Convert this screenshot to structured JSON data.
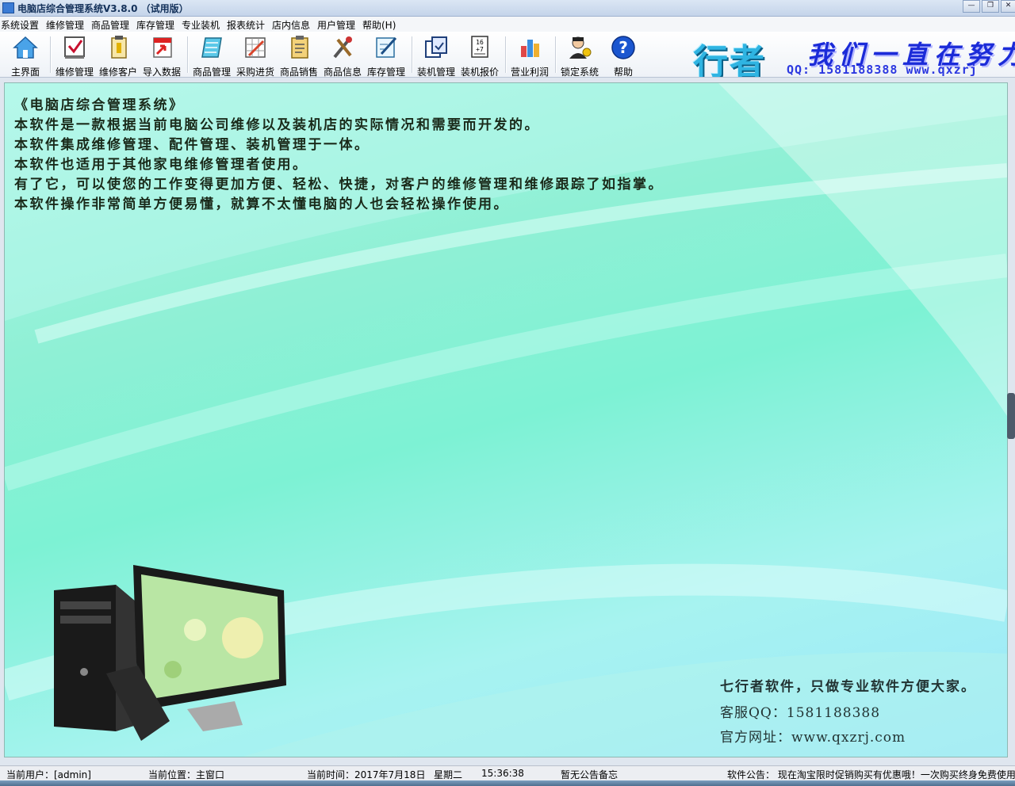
{
  "window": {
    "title": "电脑店综合管理系统V3.8.0 （试用版）",
    "controls": [
      "—",
      "❐",
      "✕"
    ]
  },
  "menu": [
    "系统设置",
    "维修管理",
    "商品管理",
    "库存管理",
    "专业装机",
    "报表统计",
    "店内信息",
    "用户管理",
    "帮助(H)"
  ],
  "toolbar": {
    "buttons": [
      {
        "label": "主界面",
        "icon": "house-icon"
      },
      {
        "label": "维修管理",
        "icon": "checkbox-board-icon"
      },
      {
        "label": "维修客户",
        "icon": "customer-card-icon"
      },
      {
        "label": "导入数据",
        "icon": "import-arrow-icon"
      },
      {
        "label": "商品管理",
        "icon": "notebook-icon"
      },
      {
        "label": "采购进货",
        "icon": "purchase-grid-icon"
      },
      {
        "label": "商品销售",
        "icon": "sales-clipboard-icon"
      },
      {
        "label": "商品信息",
        "icon": "tools-icon"
      },
      {
        "label": "库存管理",
        "icon": "inventory-pencil-icon"
      },
      {
        "label": "装机管理",
        "icon": "assembly-docs-icon"
      },
      {
        "label": "装机报价",
        "icon": "quote-calculator-icon"
      },
      {
        "label": "营业利润",
        "icon": "bar-chart-icon"
      },
      {
        "label": "锁定系统",
        "icon": "lock-user-icon"
      },
      {
        "label": "帮助",
        "icon": "help-icon"
      }
    ]
  },
  "brand": {
    "name": "行者",
    "slogan": "我们一直在努力",
    "contact": "QQ: 1581188388  www.qxzrj"
  },
  "intro": [
    "《电脑店综合管理系统》",
    "本软件是一款根据当前电脑公司维修以及装机店的实际情况和需要而开发的。",
    "本软件集成维修管理、配件管理、装机管理于一体。",
    "本软件也适用于其他家电维修管理者使用。",
    "有了它，可以使您的工作变得更加方便、轻松、快捷，对客户的维修管理和维修跟踪了如指掌。",
    "本软件操作非常简单方便易懂，就算不太懂电脑的人也会轻松操作使用。"
  ],
  "footer": {
    "slogan": "七行者软件，只做专业软件方便大家。",
    "qq": "客服QQ：1581188388",
    "site": "官方网址：www.qxzrj.com"
  },
  "status": {
    "user": "当前用户：[admin]",
    "location": "当前位置：主窗口",
    "time": "当前时间：2017年7月18日",
    "weekday": "星期二",
    "clock": "15:36:38",
    "memo": "暂无公告备忘",
    "notice": "软件公告：  现在淘宝限时促销购买有优惠哦！一次购买终身免费使用"
  },
  "colors": {
    "accent": "#2fb4e2",
    "slogan": "#1b2bd8",
    "main_bg": "#8ff0d5"
  }
}
